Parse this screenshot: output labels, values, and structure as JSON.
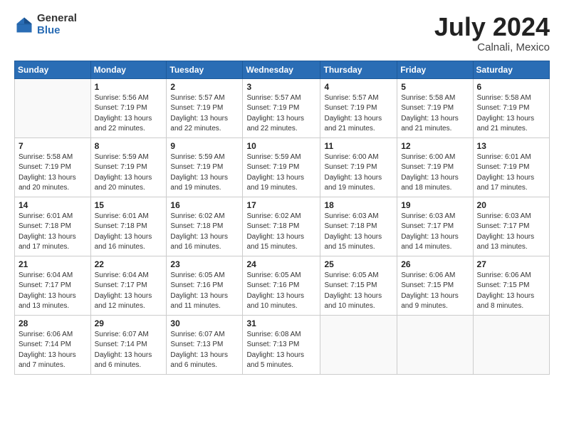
{
  "logo": {
    "general": "General",
    "blue": "Blue"
  },
  "title": {
    "month_year": "July 2024",
    "location": "Calnali, Mexico"
  },
  "weekdays": [
    "Sunday",
    "Monday",
    "Tuesday",
    "Wednesday",
    "Thursday",
    "Friday",
    "Saturday"
  ],
  "weeks": [
    [
      {
        "day": "",
        "info": ""
      },
      {
        "day": "1",
        "info": "Sunrise: 5:56 AM\nSunset: 7:19 PM\nDaylight: 13 hours\nand 22 minutes."
      },
      {
        "day": "2",
        "info": "Sunrise: 5:57 AM\nSunset: 7:19 PM\nDaylight: 13 hours\nand 22 minutes."
      },
      {
        "day": "3",
        "info": "Sunrise: 5:57 AM\nSunset: 7:19 PM\nDaylight: 13 hours\nand 22 minutes."
      },
      {
        "day": "4",
        "info": "Sunrise: 5:57 AM\nSunset: 7:19 PM\nDaylight: 13 hours\nand 21 minutes."
      },
      {
        "day": "5",
        "info": "Sunrise: 5:58 AM\nSunset: 7:19 PM\nDaylight: 13 hours\nand 21 minutes."
      },
      {
        "day": "6",
        "info": "Sunrise: 5:58 AM\nSunset: 7:19 PM\nDaylight: 13 hours\nand 21 minutes."
      }
    ],
    [
      {
        "day": "7",
        "info": "Sunrise: 5:58 AM\nSunset: 7:19 PM\nDaylight: 13 hours\nand 20 minutes."
      },
      {
        "day": "8",
        "info": "Sunrise: 5:59 AM\nSunset: 7:19 PM\nDaylight: 13 hours\nand 20 minutes."
      },
      {
        "day": "9",
        "info": "Sunrise: 5:59 AM\nSunset: 7:19 PM\nDaylight: 13 hours\nand 19 minutes."
      },
      {
        "day": "10",
        "info": "Sunrise: 5:59 AM\nSunset: 7:19 PM\nDaylight: 13 hours\nand 19 minutes."
      },
      {
        "day": "11",
        "info": "Sunrise: 6:00 AM\nSunset: 7:19 PM\nDaylight: 13 hours\nand 19 minutes."
      },
      {
        "day": "12",
        "info": "Sunrise: 6:00 AM\nSunset: 7:19 PM\nDaylight: 13 hours\nand 18 minutes."
      },
      {
        "day": "13",
        "info": "Sunrise: 6:01 AM\nSunset: 7:19 PM\nDaylight: 13 hours\nand 17 minutes."
      }
    ],
    [
      {
        "day": "14",
        "info": "Sunrise: 6:01 AM\nSunset: 7:18 PM\nDaylight: 13 hours\nand 17 minutes."
      },
      {
        "day": "15",
        "info": "Sunrise: 6:01 AM\nSunset: 7:18 PM\nDaylight: 13 hours\nand 16 minutes."
      },
      {
        "day": "16",
        "info": "Sunrise: 6:02 AM\nSunset: 7:18 PM\nDaylight: 13 hours\nand 16 minutes."
      },
      {
        "day": "17",
        "info": "Sunrise: 6:02 AM\nSunset: 7:18 PM\nDaylight: 13 hours\nand 15 minutes."
      },
      {
        "day": "18",
        "info": "Sunrise: 6:03 AM\nSunset: 7:18 PM\nDaylight: 13 hours\nand 15 minutes."
      },
      {
        "day": "19",
        "info": "Sunrise: 6:03 AM\nSunset: 7:17 PM\nDaylight: 13 hours\nand 14 minutes."
      },
      {
        "day": "20",
        "info": "Sunrise: 6:03 AM\nSunset: 7:17 PM\nDaylight: 13 hours\nand 13 minutes."
      }
    ],
    [
      {
        "day": "21",
        "info": "Sunrise: 6:04 AM\nSunset: 7:17 PM\nDaylight: 13 hours\nand 13 minutes."
      },
      {
        "day": "22",
        "info": "Sunrise: 6:04 AM\nSunset: 7:17 PM\nDaylight: 13 hours\nand 12 minutes."
      },
      {
        "day": "23",
        "info": "Sunrise: 6:05 AM\nSunset: 7:16 PM\nDaylight: 13 hours\nand 11 minutes."
      },
      {
        "day": "24",
        "info": "Sunrise: 6:05 AM\nSunset: 7:16 PM\nDaylight: 13 hours\nand 10 minutes."
      },
      {
        "day": "25",
        "info": "Sunrise: 6:05 AM\nSunset: 7:15 PM\nDaylight: 13 hours\nand 10 minutes."
      },
      {
        "day": "26",
        "info": "Sunrise: 6:06 AM\nSunset: 7:15 PM\nDaylight: 13 hours\nand 9 minutes."
      },
      {
        "day": "27",
        "info": "Sunrise: 6:06 AM\nSunset: 7:15 PM\nDaylight: 13 hours\nand 8 minutes."
      }
    ],
    [
      {
        "day": "28",
        "info": "Sunrise: 6:06 AM\nSunset: 7:14 PM\nDaylight: 13 hours\nand 7 minutes."
      },
      {
        "day": "29",
        "info": "Sunrise: 6:07 AM\nSunset: 7:14 PM\nDaylight: 13 hours\nand 6 minutes."
      },
      {
        "day": "30",
        "info": "Sunrise: 6:07 AM\nSunset: 7:13 PM\nDaylight: 13 hours\nand 6 minutes."
      },
      {
        "day": "31",
        "info": "Sunrise: 6:08 AM\nSunset: 7:13 PM\nDaylight: 13 hours\nand 5 minutes."
      },
      {
        "day": "",
        "info": ""
      },
      {
        "day": "",
        "info": ""
      },
      {
        "day": "",
        "info": ""
      }
    ]
  ]
}
